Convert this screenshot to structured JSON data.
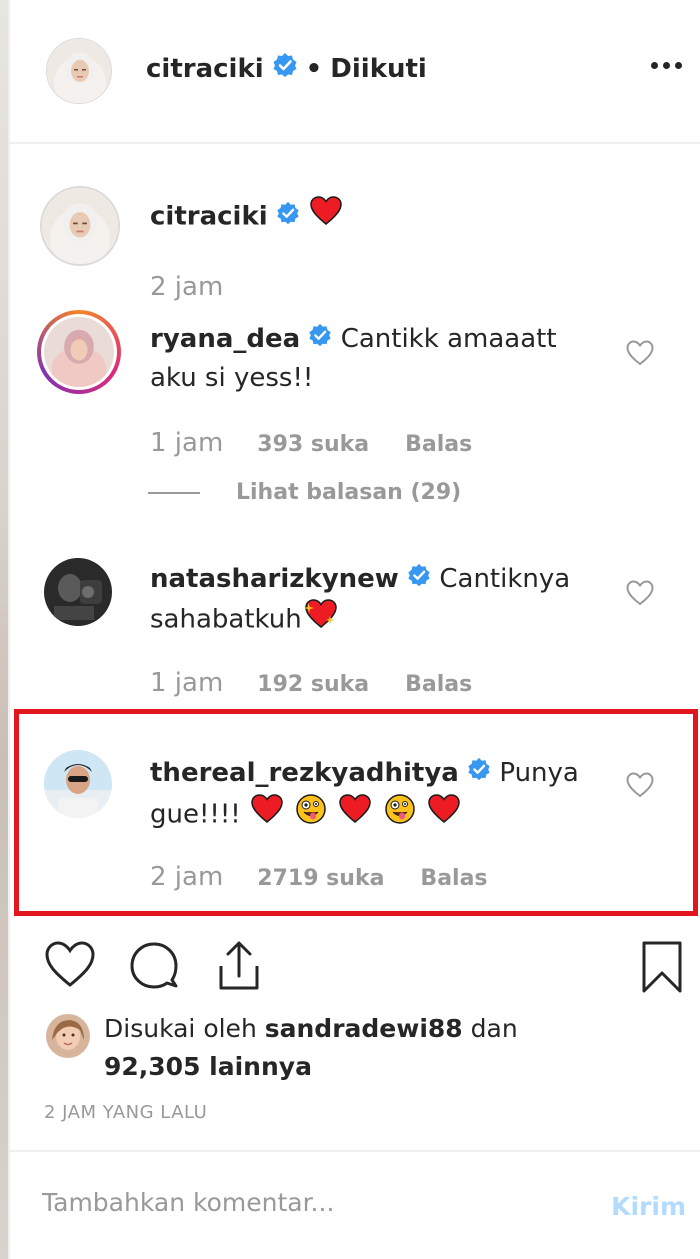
{
  "header": {
    "username": "citraciki",
    "separator": "•",
    "follow_status": "Diikuti"
  },
  "caption": {
    "username": "citraciki",
    "time": "2 jam"
  },
  "comments": [
    {
      "username": "ryana_dea",
      "text_line1": "Cantikk amaaatt",
      "text_line2": "aku si yess!!",
      "time": "1 jam",
      "likes": "393 suka",
      "reply": "Balas",
      "view_replies": "Lihat balasan (29)"
    },
    {
      "username": "natasharizkynew",
      "text_line1": "Cantiknya",
      "text_line2": "sahabatkuh",
      "time": "1 jam",
      "likes": "192 suka",
      "reply": "Balas"
    },
    {
      "username": "thereal_rezkyadhitya",
      "text_line1": "Punya",
      "text_line2": "gue!!!!",
      "time": "2 jam",
      "likes": "2719 suka",
      "reply": "Balas"
    }
  ],
  "likes": {
    "prefix": "Disukai oleh",
    "user": "sandradewi88",
    "conj": "dan",
    "count": "92,305 lainnya"
  },
  "time_ago": "2 JAM YANG LALU",
  "comment_box": {
    "placeholder": "Tambahkan komentar...",
    "send": "Kirim"
  },
  "colors": {
    "highlight": "#e2161d",
    "verified": "#3897f0",
    "heart": "#ed1c24",
    "send_disabled": "#b3dbff"
  }
}
